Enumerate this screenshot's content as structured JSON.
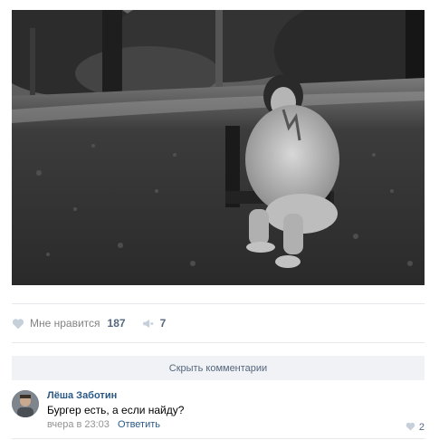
{
  "post": {
    "image_icon": "photo-black-white-park-portrait",
    "likes_label": "Мне нравится",
    "likes_count": "187",
    "shares_count": "7"
  },
  "comments": {
    "hide_label": "Скрыть комментарии",
    "items": [
      {
        "author": "Лёша Заботин",
        "text": "Бургер есть, а если найду?",
        "time": "вчера в 23:03",
        "reply_label": "Ответить",
        "likes": "2"
      }
    ]
  },
  "colors": {
    "link": "#2a5885",
    "muted": "#828282",
    "bar_bg": "#f0f2f5",
    "icon": "#c5d0db"
  }
}
